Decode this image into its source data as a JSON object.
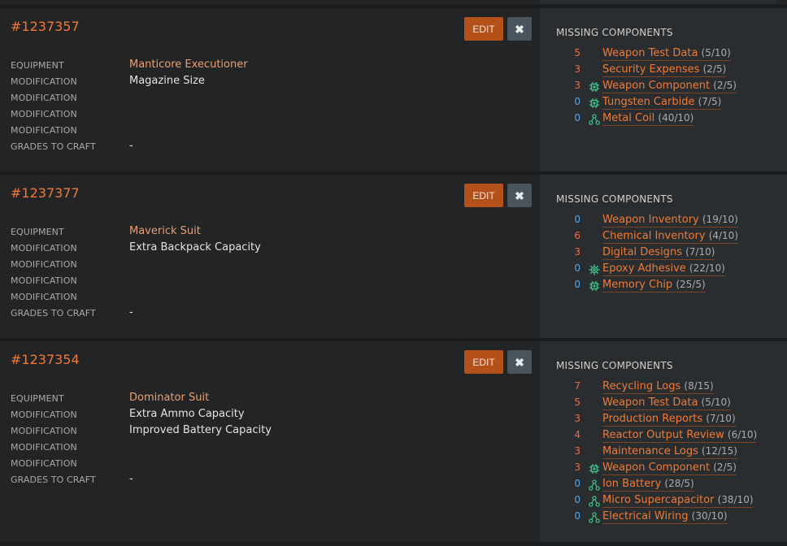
{
  "buttons": {
    "edit_label": "EDIT",
    "delete_glyph": "✖"
  },
  "section_title": "MISSING COMPONENTS",
  "colors": {
    "accent": "#f07a35",
    "edit_bg": "#b4501a",
    "count_red": "#f06a45",
    "count_blue": "#5aa7e8",
    "icon_green": "#3fc08a"
  },
  "cards": [
    {
      "id": "#1237357",
      "props": [
        {
          "label": "EQUIPMENT",
          "value": "Manticore Executioner"
        },
        {
          "label": "MODIFICATION",
          "value": "Magazine Size"
        },
        {
          "label": "MODIFICATION",
          "value": ""
        },
        {
          "label": "MODIFICATION",
          "value": ""
        },
        {
          "label": "MODIFICATION",
          "value": ""
        },
        {
          "label": "GRADES TO CRAFT",
          "value": "-"
        }
      ],
      "components": [
        {
          "count": "5",
          "icon": "",
          "name": "Weapon Test Data",
          "frac": "(5/10)"
        },
        {
          "count": "3",
          "icon": "",
          "name": "Security Expenses",
          "frac": "(2/5)"
        },
        {
          "count": "3",
          "icon": "chip-icon",
          "name": "Weapon Component",
          "frac": "(2/5)"
        },
        {
          "count": "0",
          "icon": "chip-icon",
          "name": "Tungsten Carbide",
          "frac": "(7/5)"
        },
        {
          "count": "0",
          "icon": "network-icon",
          "name": "Metal Coil",
          "frac": "(40/10)"
        }
      ]
    },
    {
      "id": "#1237377",
      "props": [
        {
          "label": "EQUIPMENT",
          "value": "Maverick Suit"
        },
        {
          "label": "MODIFICATION",
          "value": "Extra Backpack Capacity"
        },
        {
          "label": "MODIFICATION",
          "value": ""
        },
        {
          "label": "MODIFICATION",
          "value": ""
        },
        {
          "label": "MODIFICATION",
          "value": ""
        },
        {
          "label": "GRADES TO CRAFT",
          "value": "-"
        }
      ],
      "components": [
        {
          "count": "0",
          "icon": "",
          "name": "Weapon Inventory",
          "frac": "(19/10)"
        },
        {
          "count": "6",
          "icon": "",
          "name": "Chemical Inventory",
          "frac": "(4/10)"
        },
        {
          "count": "3",
          "icon": "",
          "name": "Digital Designs",
          "frac": "(7/10)"
        },
        {
          "count": "0",
          "icon": "gear-icon",
          "name": "Epoxy Adhesive",
          "frac": "(22/10)"
        },
        {
          "count": "0",
          "icon": "chip-icon",
          "name": "Memory Chip",
          "frac": "(25/5)"
        }
      ]
    },
    {
      "id": "#1237354",
      "props": [
        {
          "label": "EQUIPMENT",
          "value": "Dominator Suit"
        },
        {
          "label": "MODIFICATION",
          "value": "Extra Ammo Capacity"
        },
        {
          "label": "MODIFICATION",
          "value": "Improved Battery Capacity"
        },
        {
          "label": "MODIFICATION",
          "value": ""
        },
        {
          "label": "MODIFICATION",
          "value": ""
        },
        {
          "label": "GRADES TO CRAFT",
          "value": "-"
        }
      ],
      "components": [
        {
          "count": "7",
          "icon": "",
          "name": "Recycling Logs",
          "frac": "(8/15)"
        },
        {
          "count": "5",
          "icon": "",
          "name": "Weapon Test Data",
          "frac": "(5/10)"
        },
        {
          "count": "3",
          "icon": "",
          "name": "Production Reports",
          "frac": "(7/10)"
        },
        {
          "count": "4",
          "icon": "",
          "name": "Reactor Output Review",
          "frac": "(6/10)"
        },
        {
          "count": "3",
          "icon": "",
          "name": "Maintenance Logs",
          "frac": "(12/15)"
        },
        {
          "count": "3",
          "icon": "chip-icon",
          "name": "Weapon Component",
          "frac": "(2/5)"
        },
        {
          "count": "0",
          "icon": "network-icon",
          "name": "Ion Battery",
          "frac": "(28/5)"
        },
        {
          "count": "0",
          "icon": "network-icon",
          "name": "Micro Supercapacitor",
          "frac": "(38/10)"
        },
        {
          "count": "0",
          "icon": "network-icon",
          "name": "Electrical Wiring",
          "frac": "(30/10)"
        }
      ]
    }
  ]
}
